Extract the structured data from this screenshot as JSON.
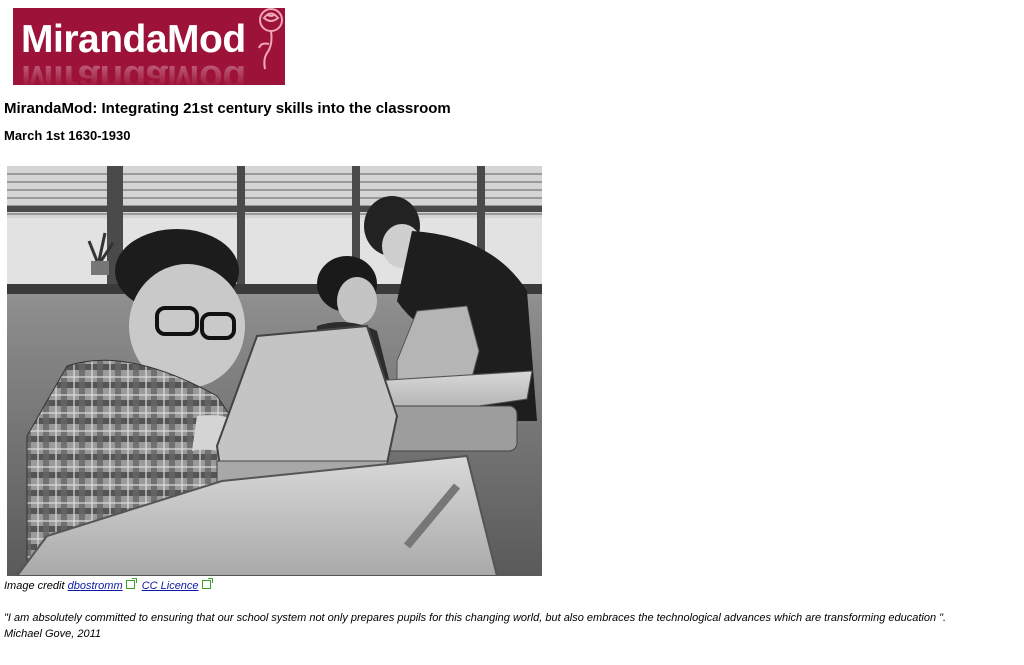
{
  "logo": {
    "text": "MirandaMod",
    "colors": {
      "background": "#9d1238",
      "text": "#ffffff",
      "rose": "#f0a6b8"
    },
    "icon": "rose-icon"
  },
  "header": {
    "title": "MirandaMod: Integrating 21st century skills into the classroom",
    "date": "March 1st 1630-1930"
  },
  "photo": {
    "description_icon": "classroom-photo"
  },
  "caption": {
    "prefix": "Image credit",
    "author_link": "dbostromm",
    "licence_link": "CC Licence",
    "link_color": "#0a1aa6",
    "external_icon": "external-link-icon"
  },
  "quote": {
    "text": "\"I am absolutely committed to ensuring that our school system not only prepares pupils for this changing world, but also embraces the technological advances which are transforming education \".",
    "attribution": "Michael Gove, 2011"
  }
}
